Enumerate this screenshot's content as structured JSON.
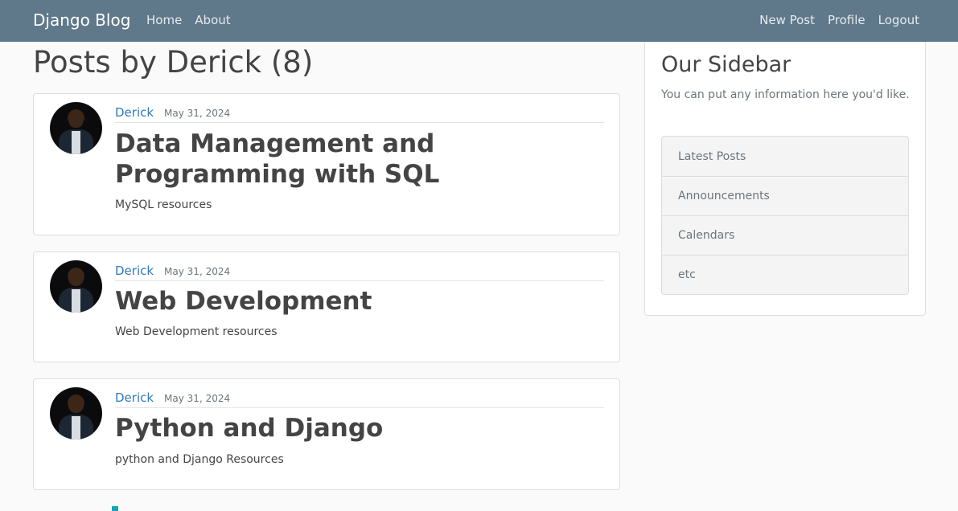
{
  "navbar": {
    "brand": "Django Blog",
    "left_links": [
      "Home",
      "About"
    ],
    "right_links": [
      "New Post",
      "Profile",
      "Logout"
    ]
  },
  "main": {
    "title": "Posts by Derick (8)",
    "posts": [
      {
        "author": "Derick",
        "date": "May 31, 2024",
        "title": "Data Management and Programming with SQL",
        "content": "MySQL resources"
      },
      {
        "author": "Derick",
        "date": "May 31, 2024",
        "title": "Web Development",
        "content": "Web Development resources"
      },
      {
        "author": "Derick",
        "date": "May 31, 2024",
        "title": "Python and Django",
        "content": "python and Django Resources"
      }
    ]
  },
  "sidebar": {
    "title": "Our Sidebar",
    "text": "You can put any information here you'd like.",
    "items": [
      "Latest Posts",
      "Announcements",
      "Calendars",
      "etc"
    ]
  },
  "colors": {
    "navbar": "#5f788a",
    "link": "#2f7ab9",
    "accent": "#17a2b8"
  }
}
